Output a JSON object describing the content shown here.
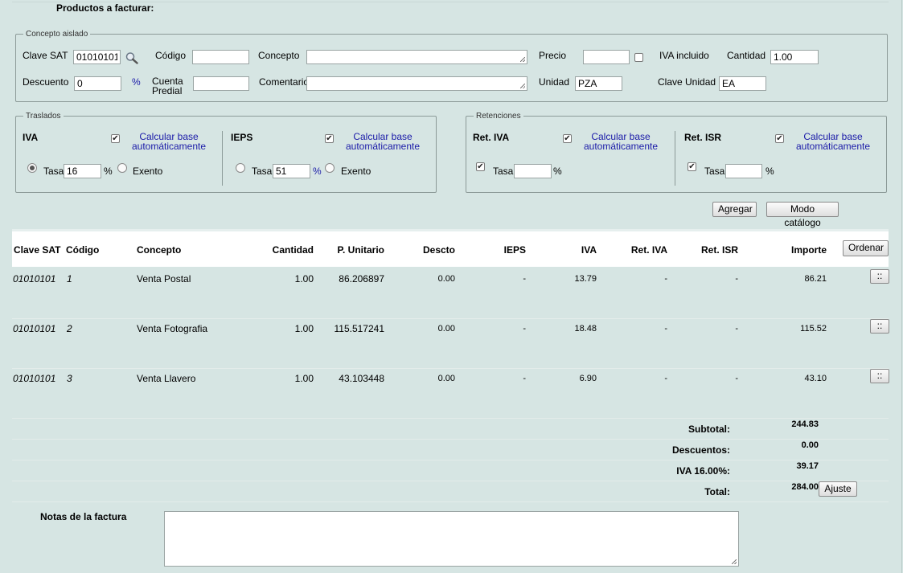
{
  "section_title": "Productos a facturar:",
  "concepto": {
    "legend": "Concepto aislado",
    "clave_sat_label": "Clave SAT",
    "clave_sat_value": "01010101",
    "codigo_label": "Código",
    "codigo_value": "",
    "concepto_label": "Concepto",
    "concepto_value": "",
    "precio_label": "Precio",
    "precio_value": "",
    "iva_incluido_label": "IVA incluido",
    "cantidad_label": "Cantidad",
    "cantidad_value": "1.00",
    "descuento_label": "Descuento",
    "descuento_value": "0",
    "percent": "%",
    "cuenta_predial_label_1": "Cuenta",
    "cuenta_predial_label_2": "Predial",
    "cuenta_predial_value": "",
    "comentario_label": "Comentario",
    "comentario_value": "",
    "unidad_label": "Unidad",
    "unidad_value": "PZA",
    "clave_unidad_label": "Clave Unidad",
    "clave_unidad_value": "EA"
  },
  "traslados": {
    "legend": "Traslados",
    "iva": {
      "label": "IVA",
      "calc_1": "Calcular base",
      "calc_2": "automáticamente",
      "tasa_label": "Tasa",
      "tasa_value": "16",
      "percent": "%",
      "exento_label": "Exento"
    },
    "ieps": {
      "label": "IEPS",
      "calc_1": "Calcular base",
      "calc_2": "automáticamente",
      "tasa_label": "Tasa",
      "tasa_value": "51",
      "percent": "%",
      "exento_label": "Exento"
    }
  },
  "retenciones": {
    "legend": "Retenciones",
    "ret_iva": {
      "label": "Ret. IVA",
      "calc_1": "Calcular base",
      "calc_2": "automáticamente",
      "tasa_label": "Tasa",
      "tasa_value": "",
      "percent": "%"
    },
    "ret_isr": {
      "label": "Ret. ISR",
      "calc_1": "Calcular base",
      "calc_2": "automáticamente",
      "tasa_label": "Tasa",
      "tasa_value": "",
      "percent": "%"
    }
  },
  "buttons": {
    "agregar": "Agregar",
    "modo_catalogo": "Modo catálogo",
    "ordenar": "Ordenar",
    "row_menu": "::",
    "ajuste": "Ajuste"
  },
  "table": {
    "headers": [
      "Clave SAT",
      "Código",
      "Concepto",
      "Cantidad",
      "P. Unitario",
      "Descto",
      "IEPS",
      "IVA",
      "Ret. IVA",
      "Ret. ISR",
      "Importe"
    ],
    "rows": [
      {
        "clave": "01010101",
        "codigo": "1",
        "concepto": "Venta Postal",
        "cantidad": "1.00",
        "unitario": "86.206897",
        "descto": "0.00",
        "ieps": "-",
        "iva": "13.79",
        "ret_iva": "-",
        "ret_isr": "-",
        "importe": "86.21"
      },
      {
        "clave": "01010101",
        "codigo": "2",
        "concepto": "Venta Fotografia",
        "cantidad": "1.00",
        "unitario": "115.517241",
        "descto": "0.00",
        "ieps": "-",
        "iva": "18.48",
        "ret_iva": "-",
        "ret_isr": "-",
        "importe": "115.52"
      },
      {
        "clave": "01010101",
        "codigo": "3",
        "concepto": "Venta Llavero",
        "cantidad": "1.00",
        "unitario": "43.103448",
        "descto": "0.00",
        "ieps": "-",
        "iva": "6.90",
        "ret_iva": "-",
        "ret_isr": "-",
        "importe": "43.10"
      }
    ]
  },
  "totals": {
    "subtotal_label": "Subtotal:",
    "subtotal": "244.83",
    "descuentos_label": "Descuentos:",
    "descuentos": "0.00",
    "iva_label": "IVA 16.00%:",
    "iva": "39.17",
    "total_label": "Total:",
    "total": "284.00"
  },
  "notas_label": "Notas de la factura",
  "notas_value": ""
}
